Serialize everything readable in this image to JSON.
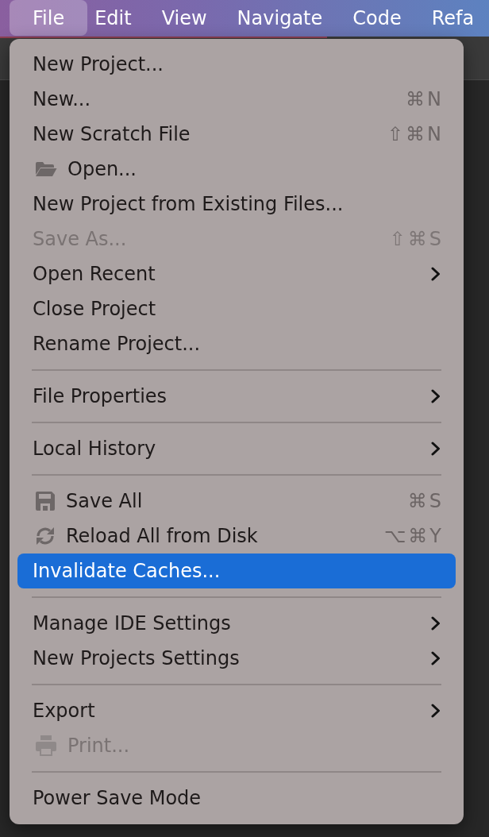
{
  "menubar": {
    "items": [
      {
        "label": "File",
        "selected": true
      },
      {
        "label": "Edit",
        "selected": false
      },
      {
        "label": "View",
        "selected": false
      },
      {
        "label": "Navigate",
        "selected": false
      },
      {
        "label": "Code",
        "selected": false
      },
      {
        "label": "Refa",
        "selected": false
      }
    ]
  },
  "menu": {
    "sections": [
      {
        "items": [
          {
            "label": "New Project...",
            "disabled": false,
            "selected": false,
            "submenu": false
          },
          {
            "label": "New...",
            "shortcut": "⌘N",
            "disabled": false,
            "selected": false,
            "submenu": false
          },
          {
            "label": "New Scratch File",
            "shortcut": "⇧⌘N",
            "disabled": false,
            "selected": false,
            "submenu": false
          },
          {
            "label": "Open...",
            "disabled": false,
            "selected": false,
            "submenu": false
          },
          {
            "label": "New Project from Existing Files...",
            "disabled": false,
            "selected": false,
            "submenu": false
          },
          {
            "label": "Save As...",
            "shortcut": "⇧⌘S",
            "disabled": true,
            "selected": false,
            "submenu": false
          },
          {
            "label": "Open Recent",
            "disabled": false,
            "selected": false,
            "submenu": true
          },
          {
            "label": "Close Project",
            "disabled": false,
            "selected": false,
            "submenu": false
          },
          {
            "label": "Rename Project...",
            "disabled": false,
            "selected": false,
            "submenu": false
          }
        ]
      },
      {
        "items": [
          {
            "label": "File Properties",
            "disabled": false,
            "selected": false,
            "submenu": true
          }
        ]
      },
      {
        "items": [
          {
            "label": "Local History",
            "disabled": false,
            "selected": false,
            "submenu": true
          }
        ]
      },
      {
        "items": [
          {
            "label": "Save All",
            "shortcut": "⌘S",
            "disabled": false,
            "selected": false,
            "submenu": false
          },
          {
            "label": "Reload All from Disk",
            "shortcut": "⌥⌘Y",
            "disabled": false,
            "selected": false,
            "submenu": false
          },
          {
            "label": "Invalidate Caches...",
            "disabled": false,
            "selected": true,
            "submenu": false
          }
        ]
      },
      {
        "items": [
          {
            "label": "Manage IDE Settings",
            "disabled": false,
            "selected": false,
            "submenu": true
          },
          {
            "label": "New Projects Settings",
            "disabled": false,
            "selected": false,
            "submenu": true
          }
        ]
      },
      {
        "items": [
          {
            "label": "Export",
            "disabled": false,
            "selected": false,
            "submenu": true
          },
          {
            "label": "Print...",
            "disabled": true,
            "selected": false,
            "submenu": false
          }
        ]
      },
      {
        "items": [
          {
            "label": "Power Save Mode",
            "disabled": false,
            "selected": false,
            "submenu": false
          }
        ]
      }
    ]
  }
}
